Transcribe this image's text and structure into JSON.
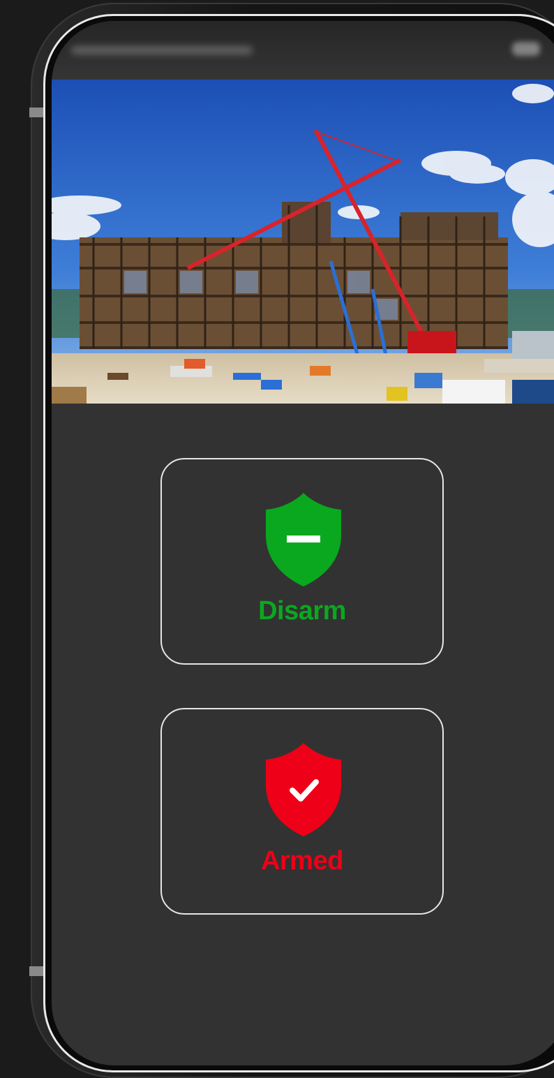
{
  "colors": {
    "disarm": "#0aa81e",
    "armed": "#ee0018",
    "card_border": "#e6e6e6",
    "screen_bg": "#323232"
  },
  "hero": {
    "icon": "construction-site-photo"
  },
  "controls": {
    "disarm": {
      "label": "Disarm",
      "icon": "shield-minus-icon"
    },
    "armed": {
      "label": "Armed",
      "icon": "shield-check-icon"
    }
  }
}
